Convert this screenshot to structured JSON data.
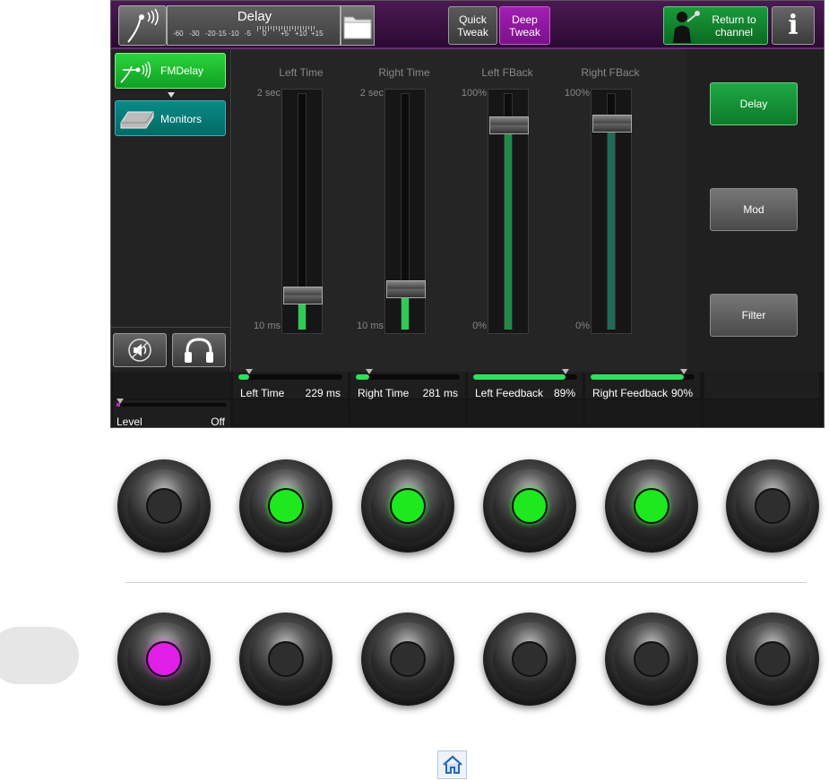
{
  "topbar": {
    "preset_name": "Delay",
    "meter_scale": [
      "-60",
      "-30",
      "-20",
      "-15",
      "-10",
      "-5",
      "0",
      "+5",
      "+10",
      "+15"
    ],
    "quick_tweak": "Quick Tweak",
    "deep_tweak": "Deep Tweak",
    "return_label": "Return to channel",
    "info_label": "i"
  },
  "chain": {
    "fmdelay": "FMDelay",
    "monitors": "Monitors"
  },
  "faders": [
    {
      "title": "Left Time",
      "top_label": "2 sec",
      "bottom_label": "10 ms",
      "level": 0.1
    },
    {
      "title": "Right Time",
      "top_label": "2 sec",
      "bottom_label": "10 ms",
      "level": 0.13
    },
    {
      "title": "Left FBack",
      "top_label": "100%",
      "bottom_label": "0%",
      "level": 0.89
    },
    {
      "title": "Right FBack",
      "top_label": "100%",
      "bottom_label": "0%",
      "level": 0.9
    }
  ],
  "tabs": {
    "delay": "Delay",
    "mod": "Mod",
    "filter": "Filter"
  },
  "strip": {
    "level_label": "Level",
    "level_value": "Off",
    "params": [
      {
        "label": "Left Time",
        "value": "229 ms",
        "level": 0.1
      },
      {
        "label": "Right Time",
        "value": "281 ms",
        "level": 0.13
      },
      {
        "label": "Left Feedback",
        "value": "89%",
        "level": 0.89
      },
      {
        "label": "Right Feedback",
        "value": "90%",
        "level": 0.9
      }
    ]
  },
  "colors": {
    "active_green": "#1ee81e",
    "active_magenta": "#e01ee6",
    "inactive": "#2e2e2e"
  },
  "knobs_row1": [
    "inactive",
    "green",
    "green",
    "green",
    "green",
    "inactive"
  ],
  "knobs_row2": [
    "magenta",
    "inactive",
    "inactive",
    "inactive",
    "inactive",
    "inactive"
  ]
}
